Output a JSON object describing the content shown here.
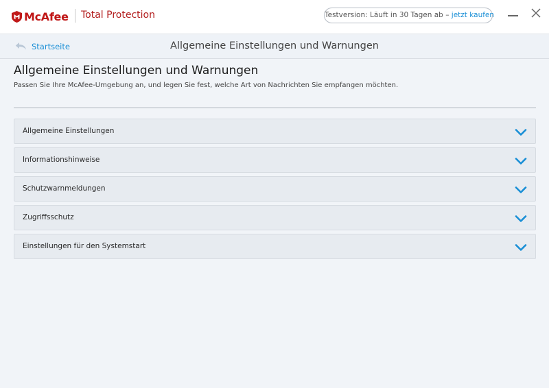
{
  "app": {
    "brand": "McAfee",
    "product": "Total Protection",
    "trial_text": "Testversion: Läuft in 30 Tagen ab – ",
    "trial_link": "jetzt kaufen"
  },
  "nav": {
    "back_label": "Startseite",
    "title": "Allgemeine Einstellungen und Warnungen"
  },
  "main": {
    "title": "Allgemeine Einstellungen und Warnungen",
    "subtitle": "Passen Sie Ihre McAfee-Umgebung an, und legen Sie fest, welche Art von Nachrichten Sie empfangen möchten.",
    "sections": [
      {
        "label": "Allgemeine Einstellungen"
      },
      {
        "label": "Informationshinweise"
      },
      {
        "label": "Schutzwarnmeldungen"
      },
      {
        "label": "Zugriffsschutz"
      },
      {
        "label": "Einstellungen für den Systemstart"
      }
    ]
  },
  "colors": {
    "brand_red": "#c01818",
    "link_blue": "#1a8fd6",
    "chevron_blue": "#1a8fd6"
  },
  "icons": {
    "logo": "mcafee-shield-icon",
    "minimize": "minimize-icon",
    "close": "close-icon",
    "back": "back-arrow-icon",
    "expand": "chevron-down-icon"
  }
}
